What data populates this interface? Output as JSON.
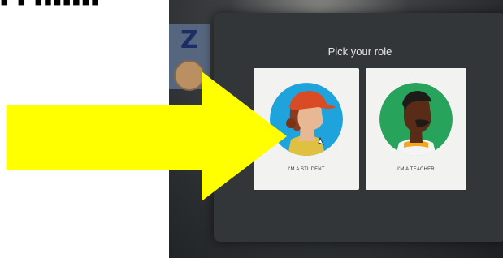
{
  "dialog": {
    "title": "Pick your role",
    "options": [
      {
        "label": "I'M A STUDENT"
      },
      {
        "label": "I'M A TEACHER"
      }
    ]
  },
  "colors": {
    "arrow": "#ffff00",
    "student_avatar_bg": "#1fa3dc",
    "teacher_avatar_bg": "#27a35b",
    "dialog_bg": "#333638"
  }
}
